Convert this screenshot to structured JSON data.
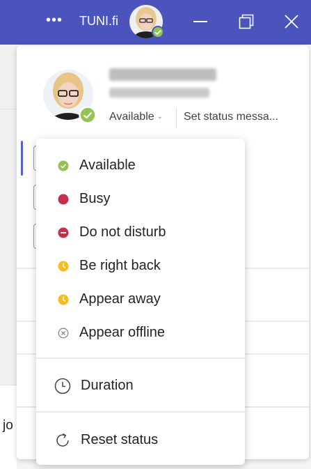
{
  "titlebar": {
    "more_glyph": "•••",
    "org_name": "TUNI.fi",
    "icons": [
      "more-icon",
      "minimize-icon",
      "maximize-icon",
      "close-icon"
    ]
  },
  "profile": {
    "status": "Available",
    "set_status_message": "Set status messa..."
  },
  "status_menu": {
    "items": [
      {
        "label": "Available",
        "icon": "available-icon",
        "color": "#92c353"
      },
      {
        "label": "Busy",
        "icon": "busy-icon",
        "color": "#c4314b"
      },
      {
        "label": "Do not disturb",
        "icon": "do-not-disturb-icon",
        "color": "#c4314b"
      },
      {
        "label": "Be right back",
        "icon": "be-right-back-icon",
        "color": "#fcba1e"
      },
      {
        "label": "Appear away",
        "icon": "appear-away-icon",
        "color": "#fcba1e"
      },
      {
        "label": "Appear offline",
        "icon": "appear-offline-icon",
        "color": "#8a8886"
      }
    ],
    "duration": "Duration",
    "reset": "Reset status"
  },
  "background": {
    "partial_text": "jo"
  },
  "colors": {
    "titlebar": "#4b53bc",
    "accent": "#5b5fc7"
  }
}
